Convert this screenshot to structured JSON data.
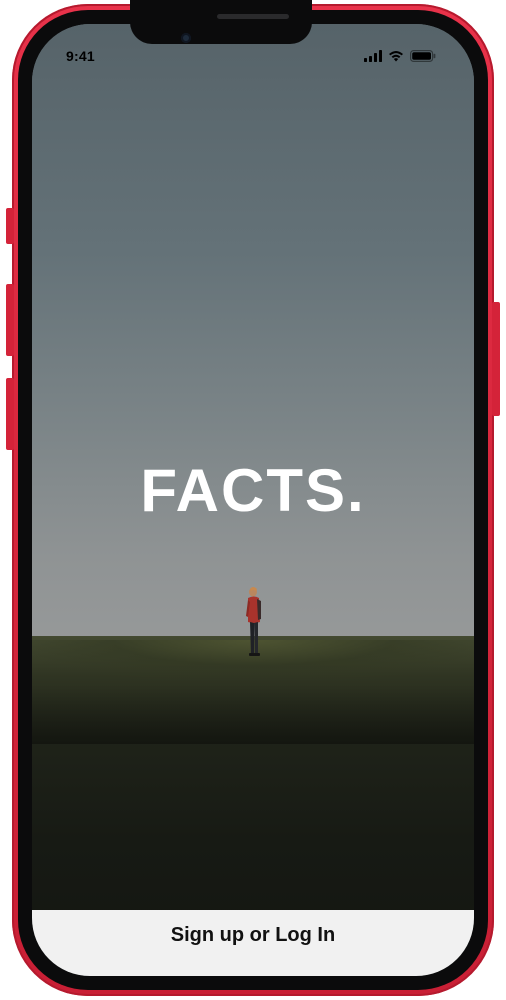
{
  "device": {
    "frame_color": "#d7263c"
  },
  "status_bar": {
    "time": "9:41",
    "icons": [
      "cellular-signal-icon",
      "wifi-icon",
      "battery-icon"
    ]
  },
  "hero": {
    "brand_title": "FACTS.",
    "background": "photo of a person standing on a grassy hill under a grey sky"
  },
  "footer": {
    "signup_label": "Sign up or Log In"
  },
  "colors": {
    "text_on_hero": "#ffffff",
    "footer_bg": "#f1f1f1",
    "footer_text": "#111111"
  }
}
